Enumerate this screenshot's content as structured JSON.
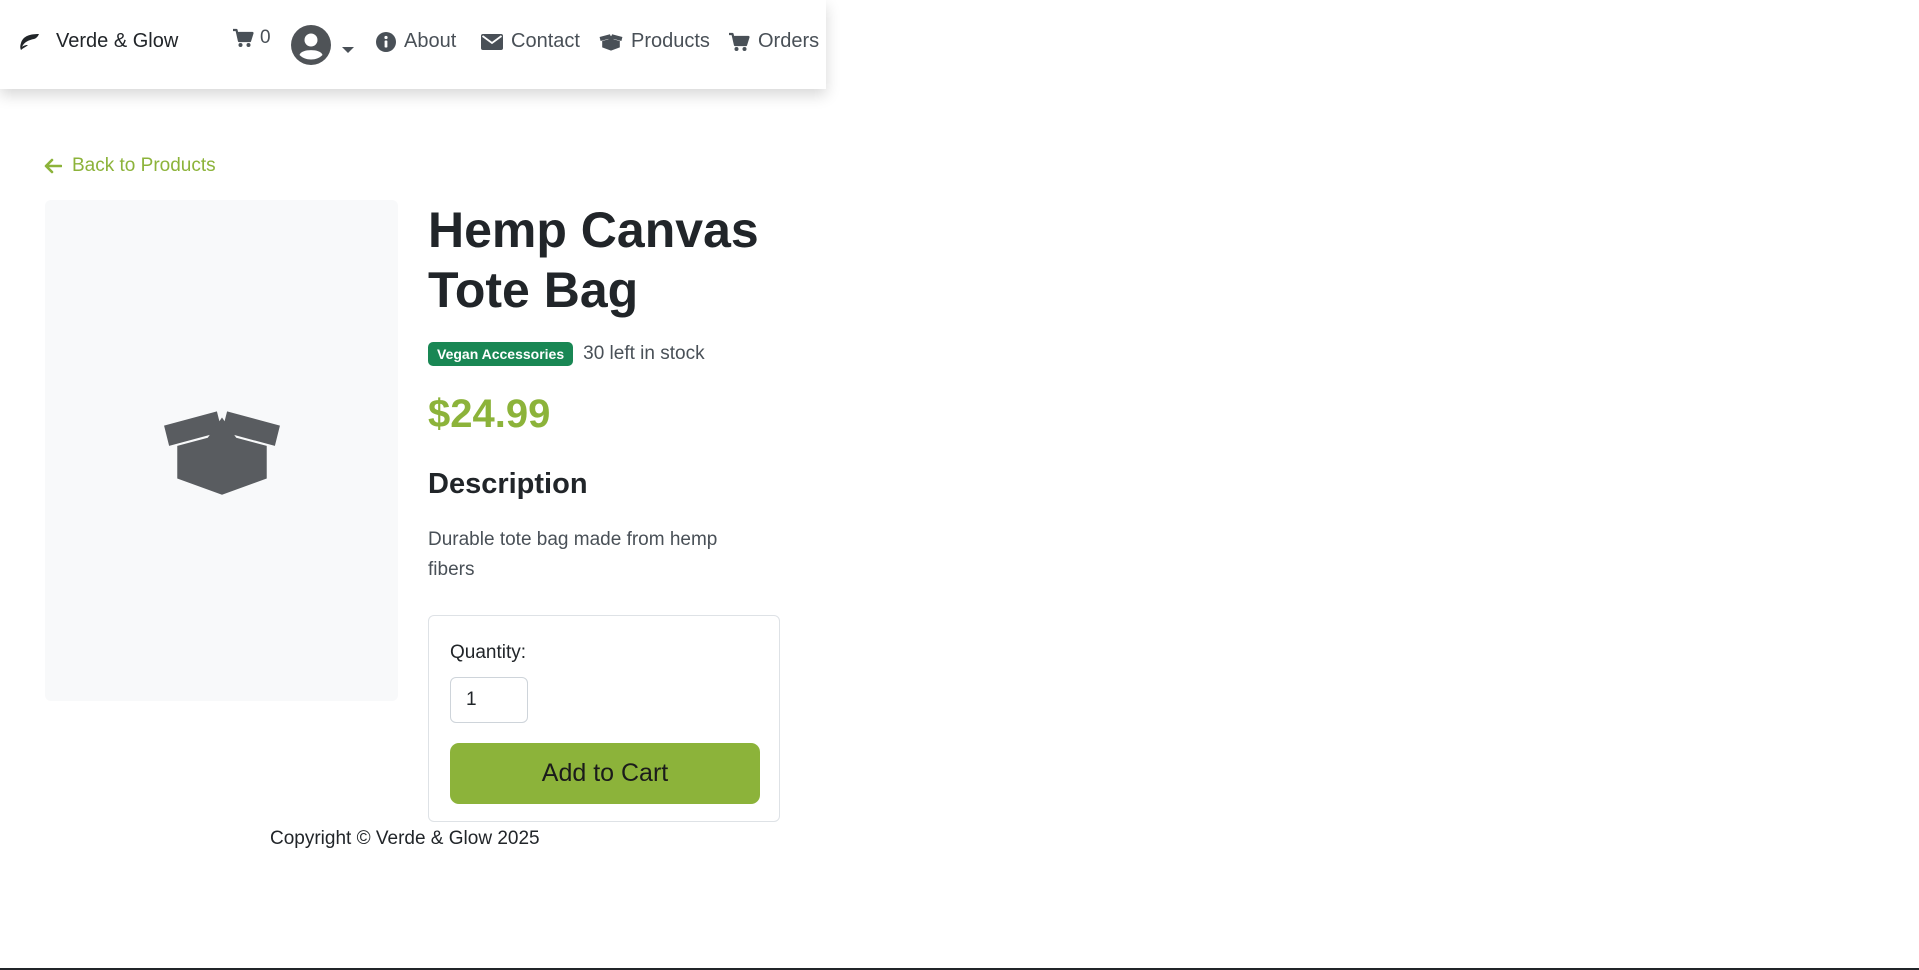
{
  "brand": {
    "name": "Verde & Glow",
    "icon": "leaf-icon"
  },
  "nav": {
    "cart_count": "0",
    "items": [
      {
        "label": "About",
        "icon": "info-circle-icon"
      },
      {
        "label": "Contact",
        "icon": "envelope-icon"
      },
      {
        "label": "Products",
        "icon": "open-box-icon"
      },
      {
        "label": "Orders",
        "icon": "cart-icon"
      }
    ]
  },
  "back_link": "Back to Products",
  "product": {
    "name": "Hemp Canvas Tote Bag",
    "category": "Vegan Accessories",
    "stock": "30 left in stock",
    "price": "$24.99",
    "description_heading": "Description",
    "description": "Durable tote bag made from hemp fibers",
    "image_icon": "open-box-icon"
  },
  "purchase": {
    "quantity_label": "Quantity:",
    "quantity_value": "1",
    "add_button": "Add to Cart"
  },
  "footer": {
    "copyright": "Copyright © Verde & Glow 2025"
  },
  "colors": {
    "accent": "#8cb33a",
    "badge": "#198754",
    "text": "#212529",
    "muted": "#495057",
    "image_bg": "#f8f9fa"
  }
}
